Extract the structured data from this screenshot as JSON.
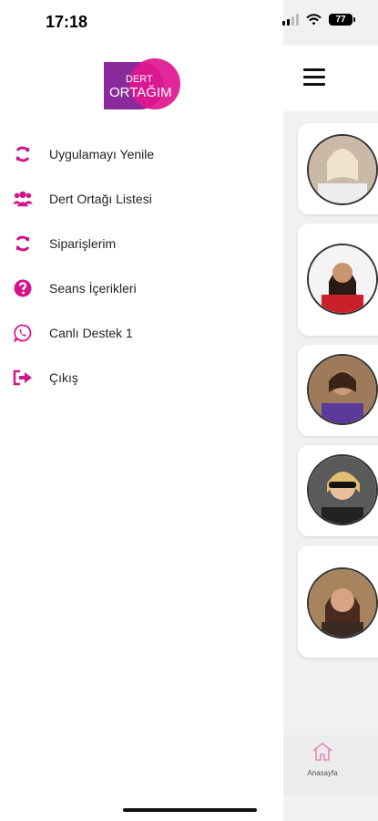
{
  "status": {
    "time": "17:18",
    "battery": "77"
  },
  "logo": {
    "line1": "DERT",
    "line2": "ORTAĞIM"
  },
  "menu": [
    {
      "label": "Uygulamayı Yenile",
      "icon": "refresh-icon"
    },
    {
      "label": "Dert Ortağı Listesi",
      "icon": "users-icon"
    },
    {
      "label": "Siparişlerim",
      "icon": "refresh-icon"
    },
    {
      "label": "Seans İçerikleri",
      "icon": "question-circle-icon"
    },
    {
      "label": "Canlı Destek 1",
      "icon": "whatsapp-icon"
    },
    {
      "label": "Çıkış",
      "icon": "logout-icon"
    }
  ],
  "tabbar": {
    "home_label": "Anasayfa"
  },
  "colors": {
    "accent": "#d4148b",
    "logo_purple": "#8b2b9b",
    "logo_pink": "#e0168f"
  }
}
